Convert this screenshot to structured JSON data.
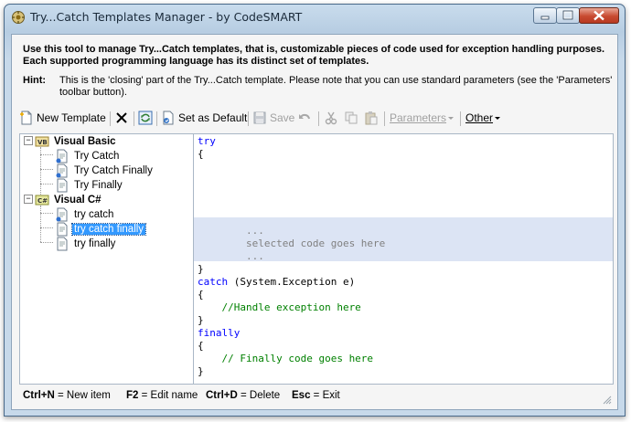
{
  "window": {
    "title": "Try...Catch Templates Manager - by CodeSMART",
    "buttons": {
      "minimize": "minimize",
      "maximize": "maximize",
      "close": "close"
    }
  },
  "intro": "Use this tool to manage Try...Catch templates, that is, customizable pieces of code used for exception handling purposes. Each supported programming language has its distinct set of templates.",
  "hint": {
    "label": "Hint:",
    "text": "This is the 'closing' part of the Try...Catch template. Please note that you can use standard parameters (see the 'Parameters' toolbar button)."
  },
  "toolbar": {
    "new_template": "New Template",
    "set_as_default": "Set as Default",
    "save": "Save",
    "parameters": "Parameters",
    "other": "Other"
  },
  "tree": {
    "groups": [
      {
        "label": "Visual Basic",
        "items": [
          "Try Catch",
          "Try Catch Finally",
          "Try Finally"
        ]
      },
      {
        "label": "Visual C#",
        "items": [
          "try catch",
          "try catch finally",
          "try finally"
        ]
      }
    ],
    "selected": "try catch finally"
  },
  "editor": {
    "lines": [
      "try",
      "{",
      "",
      "",
      "",
      "",
      "",
      "        ...",
      "        selected code goes here",
      "        ...",
      "}",
      "catch (System.Exception e)",
      "{",
      "    //Handle exception here",
      "}",
      "finally",
      "{",
      "    // Finally code goes here",
      "}"
    ]
  },
  "status": [
    {
      "key": "Ctrl+N",
      "text": " = New item"
    },
    {
      "key": "F2",
      "text": " = Edit name"
    },
    {
      "key": "Ctrl+D",
      "text": " = Delete"
    },
    {
      "key": "Esc",
      "text": " = Exit"
    }
  ],
  "colors": {
    "keyword": "#0000ff",
    "comment": "#008000",
    "placeholder": "#808080",
    "selection": "#3399ff",
    "highlight_band": "#dce4f4"
  }
}
